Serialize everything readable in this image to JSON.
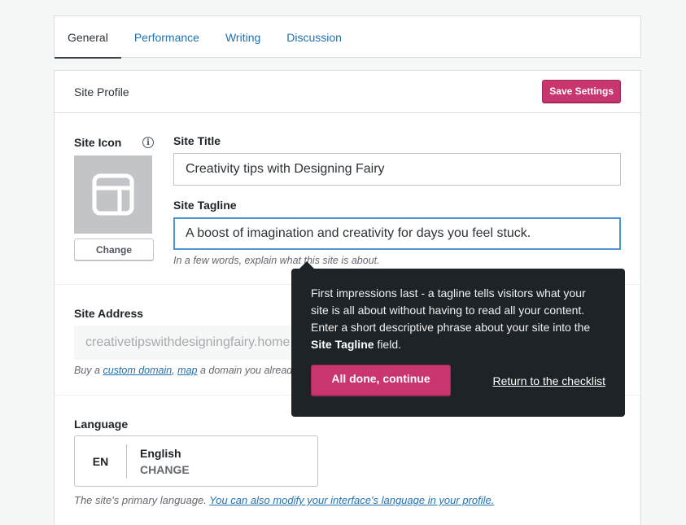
{
  "tabs": [
    {
      "label": "General",
      "active": true
    },
    {
      "label": "Performance",
      "active": false
    },
    {
      "label": "Writing",
      "active": false
    },
    {
      "label": "Discussion",
      "active": false
    }
  ],
  "card": {
    "title": "Site Profile",
    "save_label": "Save Settings"
  },
  "site_icon": {
    "label": "Site Icon",
    "info_icon": "info-icon",
    "placeholder_icon": "layout-icon",
    "change_label": "Change"
  },
  "site_title": {
    "label": "Site Title",
    "value": "Creativity tips with Designing Fairy"
  },
  "site_tagline": {
    "label": "Site Tagline",
    "value": "A boost of imagination and creativity for days you feel stuck.",
    "help": "In a few words, explain what this site is about."
  },
  "site_address": {
    "label": "Site Address",
    "value": "creativetipswithdesigningfairy.home.blog",
    "help_prefix": "Buy a ",
    "custom_domain_link": "custom domain",
    "help_sep": ", ",
    "map_link": "map",
    "help_suffix": " a domain you already own, or redirect this site."
  },
  "language": {
    "label": "Language",
    "code": "EN",
    "name": "English",
    "change_label": "CHANGE",
    "help_prefix": "The site's primary language. ",
    "help_link": "You can also modify your interface's language in your profile."
  },
  "tooltip": {
    "text": "First impressions last - a tagline tells visitors what your site is all about without having to read all your content. Enter a short descriptive phrase about your site into the ",
    "bold": "Site Tagline",
    "text_end": " field.",
    "primary_label": "All done, continue",
    "link_label": "Return to the checklist"
  },
  "colors": {
    "accent": "#c9356e",
    "link": "#2271b1",
    "tooltip_bg": "#1d2327",
    "focus": "#4f94d4"
  }
}
